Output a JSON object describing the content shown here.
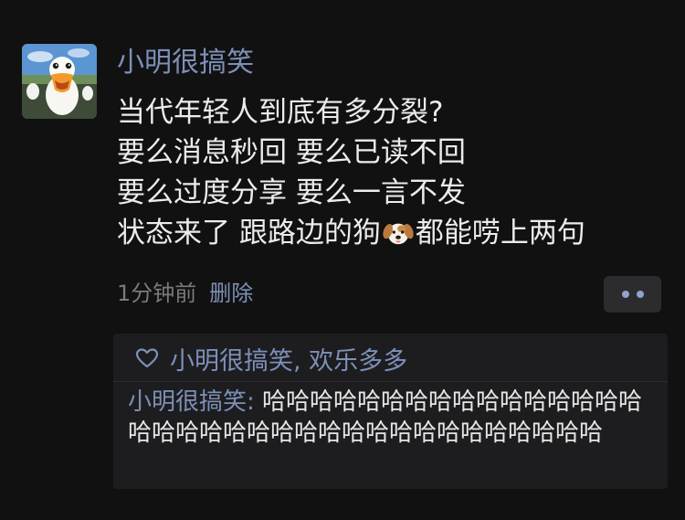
{
  "post": {
    "author": "小明很搞笑",
    "lines": [
      "当代年轻人到底有多分裂?",
      "要么消息秒回 要么已读不回",
      "要么过度分享 要么一言不发"
    ],
    "last_line_before_emoji": "状态来了 跟路边的狗",
    "emoji": "dog-face-icon",
    "last_line_after_emoji": "都能唠上两句",
    "time": "1分钟前",
    "delete_label": "删除"
  },
  "likes": {
    "names": "小明很搞笑, 欢乐多多"
  },
  "comment": {
    "author": "小明很搞笑",
    "separator": ": ",
    "text": "哈哈哈哈哈哈哈哈哈哈哈哈哈哈哈哈哈哈哈哈哈哈哈哈哈哈哈哈哈哈哈哈哈哈哈哈"
  },
  "colors": {
    "background": "#111111",
    "name_link": "#7d90b8",
    "panel": "#1d1d1f"
  }
}
